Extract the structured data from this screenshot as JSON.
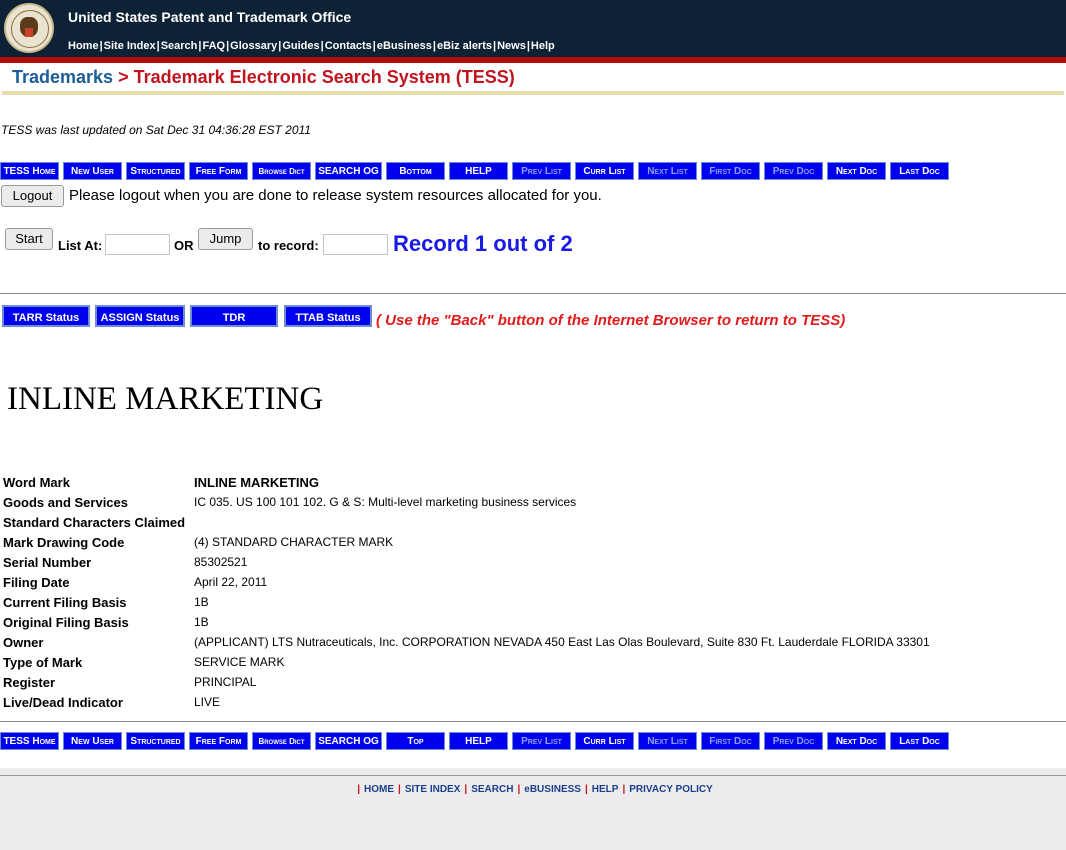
{
  "header": {
    "org_name": "United States Patent and Trademark Office",
    "nav": [
      "Home",
      "Site Index",
      "Search",
      "FAQ",
      "Glossary",
      "Guides",
      "Contacts",
      "eBusiness",
      "eBiz alerts",
      "News",
      "Help"
    ]
  },
  "breadcrumb": {
    "trademarks": "Trademarks",
    "separator": ">",
    "tess": "Trademark Electronic Search System (TESS)"
  },
  "last_updated": "TESS was last updated on Sat Dec 31 04:36:28 EST 2011",
  "top_bar": {
    "buttons": [
      "TESS Home",
      "New User",
      "Structured",
      "Free Form",
      "Browse Dict",
      "SEARCH OG",
      "Bottom",
      "HELP",
      "Prev List",
      "Curr List",
      "Next List",
      "First Doc",
      "Prev Doc",
      "Next Doc",
      "Last Doc"
    ]
  },
  "logout": {
    "button_label": "Logout",
    "message": "Please logout when you are done to release system resources allocated for you."
  },
  "list_controls": {
    "start_label": "Start",
    "list_at_label": "List At:",
    "or_label": "OR",
    "jump_label": "Jump",
    "to_record_label": "to record:",
    "list_at_value": "",
    "to_record_value": "",
    "record_text": "Record 1 out of 2"
  },
  "status_buttons": [
    "TARR Status",
    "ASSIGN Status",
    "TDR",
    "TTAB Status"
  ],
  "back_note": "( Use the \"Back\" button of the Internet Browser to return to TESS)",
  "mark_display": "INLINE MARKETING",
  "details": [
    {
      "label": "Word Mark",
      "value": "INLINE MARKETING"
    },
    {
      "label": "Goods and Services",
      "value": "IC 035. US 100 101 102. G & S: Multi-level marketing business services"
    },
    {
      "label": "Standard Characters Claimed",
      "value": ""
    },
    {
      "label": "Mark Drawing Code",
      "value": "(4) STANDARD CHARACTER MARK"
    },
    {
      "label": "Serial Number",
      "value": "85302521"
    },
    {
      "label": "Filing Date",
      "value": "April 22, 2011"
    },
    {
      "label": "Current Filing Basis",
      "value": "1B"
    },
    {
      "label": "Original Filing Basis",
      "value": "1B"
    },
    {
      "label": "Owner",
      "value": "(APPLICANT) LTS Nutraceuticals, Inc. CORPORATION NEVADA 450 East Las Olas Boulevard, Suite 830 Ft. Lauderdale FLORIDA 33301"
    },
    {
      "label": "Type of Mark",
      "value": "SERVICE MARK"
    },
    {
      "label": "Register",
      "value": "PRINCIPAL"
    },
    {
      "label": "Live/Dead Indicator",
      "value": "LIVE"
    }
  ],
  "bottom_bar": {
    "buttons": [
      "TESS Home",
      "New User",
      "Structured",
      "Free Form",
      "Browse Dict",
      "SEARCH OG",
      "Top",
      "HELP",
      "Prev List",
      "Curr List",
      "Next List",
      "First Doc",
      "Prev Doc",
      "Next Doc",
      "Last Doc"
    ]
  },
  "footer": {
    "links": [
      "HOME",
      "SITE INDEX",
      "SEARCH",
      "eBUSINESS",
      "HELP",
      "PRIVACY POLICY"
    ]
  }
}
